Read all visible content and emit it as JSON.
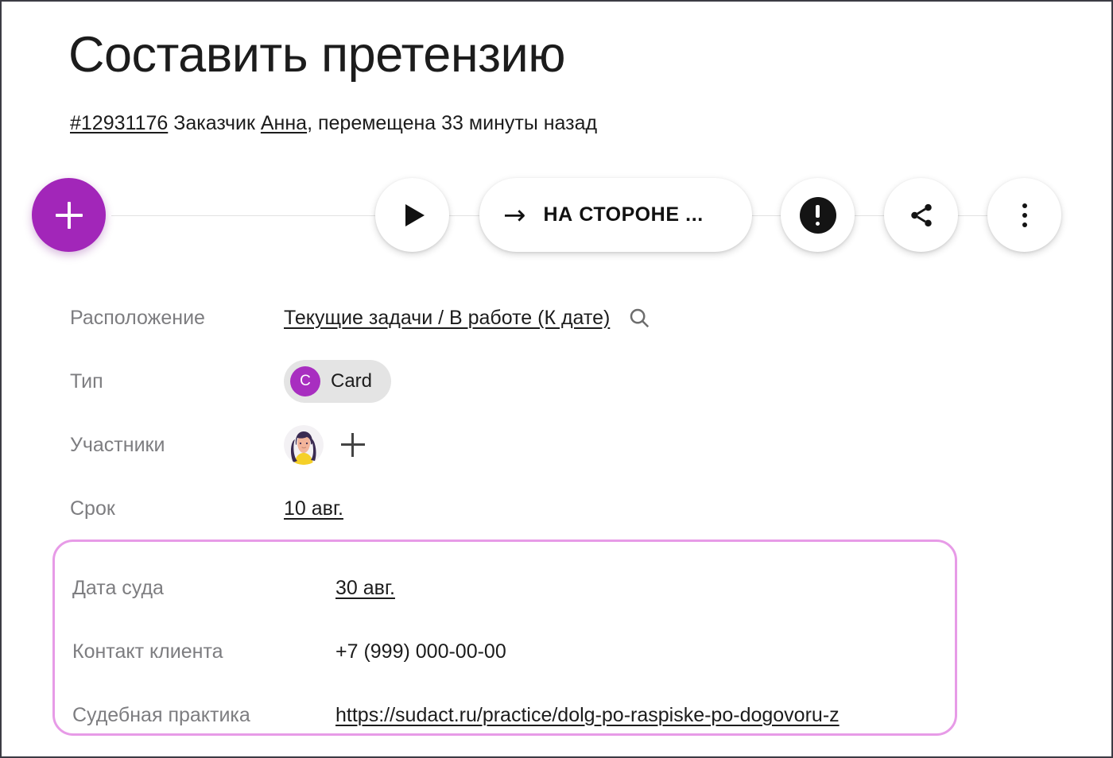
{
  "header": {
    "title": "Составить претензию",
    "ticket_id": "#12931176",
    "customer_label": "Заказчик",
    "customer_name": "Анна",
    "moved_text": ", перемещена 33 минуты назад"
  },
  "toolbar": {
    "add_label": "add-icon",
    "play_label": "play-icon",
    "stage_arrow": "→",
    "stage_label": "НА СТОРОНЕ ...",
    "alert_label": "alert-icon",
    "share_label": "share-icon",
    "more_label": "more-icon"
  },
  "fields": [
    {
      "label": "Расположение",
      "value": "Текущие задачи / В работе (К дате)",
      "type": "link-with-search"
    },
    {
      "label": "Тип",
      "chip_initial": "C",
      "chip_label": "Card",
      "type": "chip"
    },
    {
      "label": "Участники",
      "type": "avatars"
    },
    {
      "label": "Срок",
      "value": "10 авг.",
      "type": "link"
    }
  ],
  "highlighted_fields": [
    {
      "label": "Дата суда",
      "value": "30 авг.",
      "type": "link"
    },
    {
      "label": "Контакт клиента",
      "value": "+7 (999) 000-00-00",
      "type": "text"
    },
    {
      "label": "Судебная практика",
      "value": "https://sudact.ru/practice/dolg-po-raspiske-po-dogovoru-z",
      "type": "link"
    }
  ],
  "colors": {
    "accent_purple": "#a226b9",
    "highlight_border": "#e79be7",
    "label_gray": "#7d7d80",
    "text_dark": "#1c1c1c",
    "chip_bg": "#e4e4e4"
  }
}
